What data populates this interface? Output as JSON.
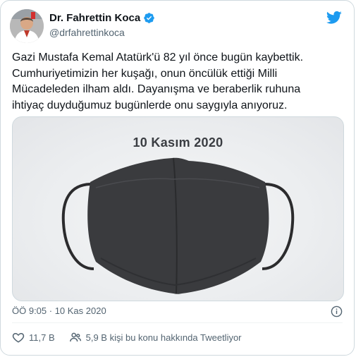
{
  "author": {
    "display_name": "Dr. Fahrettin Koca",
    "handle": "@drfahrettinkoca",
    "avatar_icon": "profile-photo",
    "verified_icon": "verified-badge-icon"
  },
  "brand": {
    "logo_icon": "twitter-bird-icon",
    "accent_color": "#1d9bf0"
  },
  "tweet": {
    "text": "Gazi Mustafa Kemal Atatürk'ü 82 yıl önce bugün kaybettik.\nCumhuriyetimizin her kuşağı, onun öncülük ettiği Milli\nMücadeleden ilham aldı. Dayanışma ve beraberlik ruhuna\nihtiyaç duyduğumuz bugünlerde onu saygıyla anıyoruz.",
    "media_caption": "10 Kasım 2020",
    "timestamp": "ÖÖ 9:05 · 10 Kas 2020"
  },
  "actions": {
    "like_count": "11,7 B",
    "talking_label": "5,9 B kişi bu konu hakkında Tweetliyor"
  }
}
